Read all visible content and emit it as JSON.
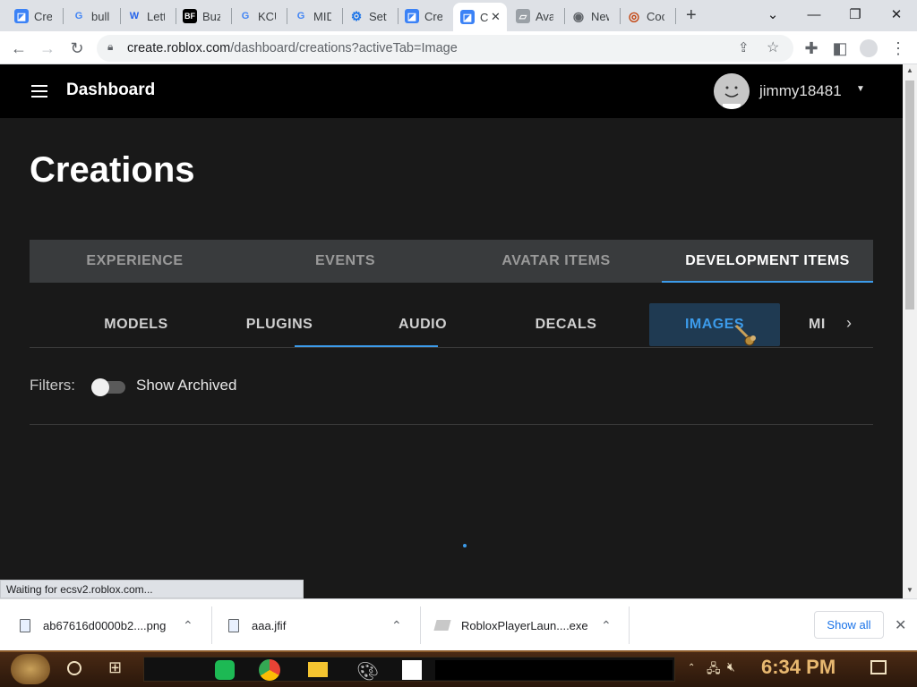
{
  "browser": {
    "tabs": [
      {
        "title": "Crea",
        "icon": "roblox-studio-icon",
        "color": "#3b82f6"
      },
      {
        "title": "bulle",
        "icon": "google-icon",
        "color": "#4285f4"
      },
      {
        "title": "Lett",
        "icon": "w-logo-icon",
        "color": "#2563eb"
      },
      {
        "title": "Buz",
        "icon": "bf-icon",
        "color": "#000000"
      },
      {
        "title": "KCU",
        "icon": "google-icon",
        "color": "#4285f4"
      },
      {
        "title": "MID",
        "icon": "google-icon",
        "color": "#4285f4"
      },
      {
        "title": "Sett",
        "icon": "gear-icon",
        "color": "#1a73e8"
      },
      {
        "title": "Crea",
        "icon": "roblox-studio-icon",
        "color": "#3b82f6"
      },
      {
        "title": "C",
        "icon": "roblox-studio-icon",
        "color": "#3b82f6"
      },
      {
        "title": "Ava",
        "icon": "roblox-icon",
        "color": "#9aa0a6"
      },
      {
        "title": "New",
        "icon": "chrome-icon",
        "color": "#5f6368"
      },
      {
        "title": "Cool",
        "icon": "target-icon",
        "color": "#c2410c"
      }
    ],
    "url_host": "create.roblox.com",
    "url_path": "/dashboard/creations?activeTab=Image"
  },
  "header": {
    "title": "Dashboard",
    "username": "jimmy18481"
  },
  "page": {
    "title": "Creations",
    "main_tabs": [
      "EXPERIENCE",
      "EVENTS",
      "AVATAR ITEMS",
      "DEVELOPMENT ITEMS"
    ],
    "active_main_tab": "DEVELOPMENT ITEMS",
    "sub_tabs": [
      "MODELS",
      "PLUGINS",
      "AUDIO",
      "DECALS",
      "IMAGES",
      "MI"
    ],
    "active_sub_tab": "IMAGES",
    "filters_label": "Filters:",
    "show_archived_label": "Show Archived",
    "show_archived_on": false
  },
  "status_text": "Waiting for ecsv2.roblox.com...",
  "downloads": {
    "items": [
      {
        "name": "ab67616d0000b2....png",
        "icon": "image-file-icon"
      },
      {
        "name": "aaa.jfif",
        "icon": "image-file-icon"
      },
      {
        "name": "RobloxPlayerLaun....exe",
        "icon": "roblox-installer-icon"
      }
    ],
    "show_all_label": "Show all"
  },
  "taskbar": {
    "clock": "6:34 PM"
  },
  "colors": {
    "accent_blue": "#3c9bea",
    "header_bg": "#000000",
    "content_bg": "#191919"
  }
}
